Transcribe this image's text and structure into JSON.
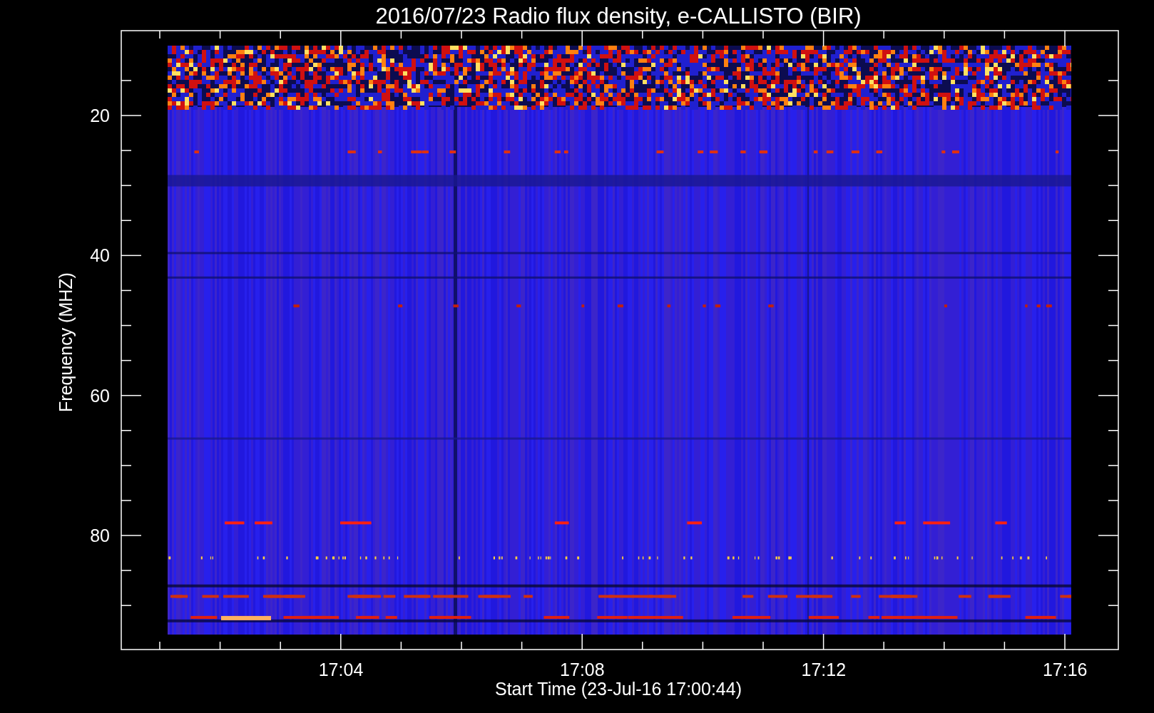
{
  "title": "2016/07/23  Radio flux density, e-CALLISTO (BIR)",
  "y_axis": {
    "label": "Frequency (MHZ)",
    "ticks": [
      "20",
      "40",
      "60",
      "80"
    ]
  },
  "x_axis": {
    "label": "Start Time (23-Jul-16 17:00:44)",
    "ticks": [
      "17:04",
      "17:08",
      "17:12",
      "17:16"
    ]
  }
}
